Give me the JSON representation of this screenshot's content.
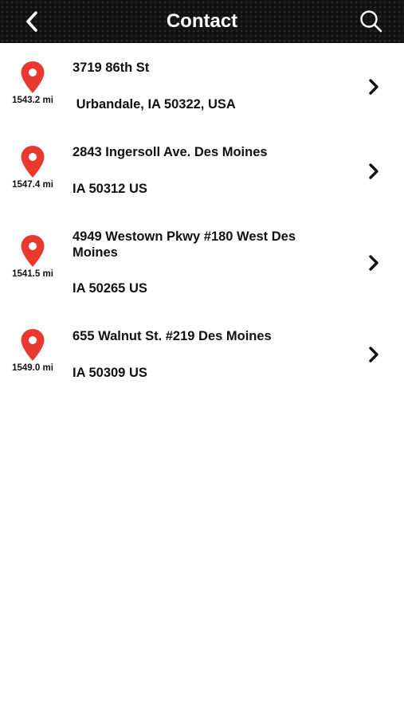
{
  "header": {
    "title": "Contact",
    "background_color": "#111111",
    "back_icon": "chevron-left-icon",
    "search_icon": "search-icon"
  },
  "accent_color": "#e8392f",
  "locations": [
    {
      "distance": "1543.2 mi",
      "address_line1": "3719 86th St",
      "address_line2": " Urbandale, IA 50322, USA"
    },
    {
      "distance": "1547.4 mi",
      "address_line1": "2843 Ingersoll Ave. Des Moines",
      "address_line2": "IA 50312 US"
    },
    {
      "distance": "1541.5 mi",
      "address_line1": "4949 Westown Pkwy #180 West Des Moines",
      "address_line2": "IA 50265 US"
    },
    {
      "distance": "1549.0 mi",
      "address_line1": "655 Walnut St. #219 Des Moines",
      "address_line2": "IA 50309 US"
    }
  ]
}
